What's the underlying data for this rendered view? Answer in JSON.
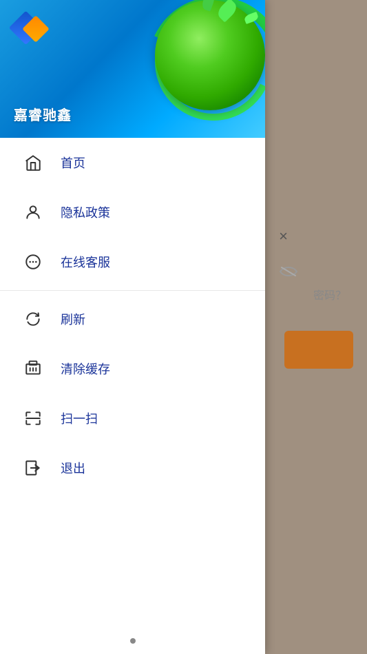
{
  "app": {
    "name": "嘉睿驰鑫"
  },
  "menu": {
    "items_group1": [
      {
        "id": "home",
        "label": "首页",
        "icon": "home-icon"
      },
      {
        "id": "privacy",
        "label": "隐私政策",
        "icon": "person-icon"
      },
      {
        "id": "service",
        "label": "在线客服",
        "icon": "chat-icon"
      }
    ],
    "items_group2": [
      {
        "id": "refresh",
        "label": "刷新",
        "icon": "refresh-icon"
      },
      {
        "id": "clear-cache",
        "label": "清除缓存",
        "icon": "cache-icon"
      },
      {
        "id": "scan",
        "label": "扫一扫",
        "icon": "scan-icon"
      },
      {
        "id": "logout",
        "label": "退出",
        "icon": "logout-icon"
      }
    ]
  },
  "right_panel": {
    "close_label": "×",
    "password_hint": "密码？"
  }
}
